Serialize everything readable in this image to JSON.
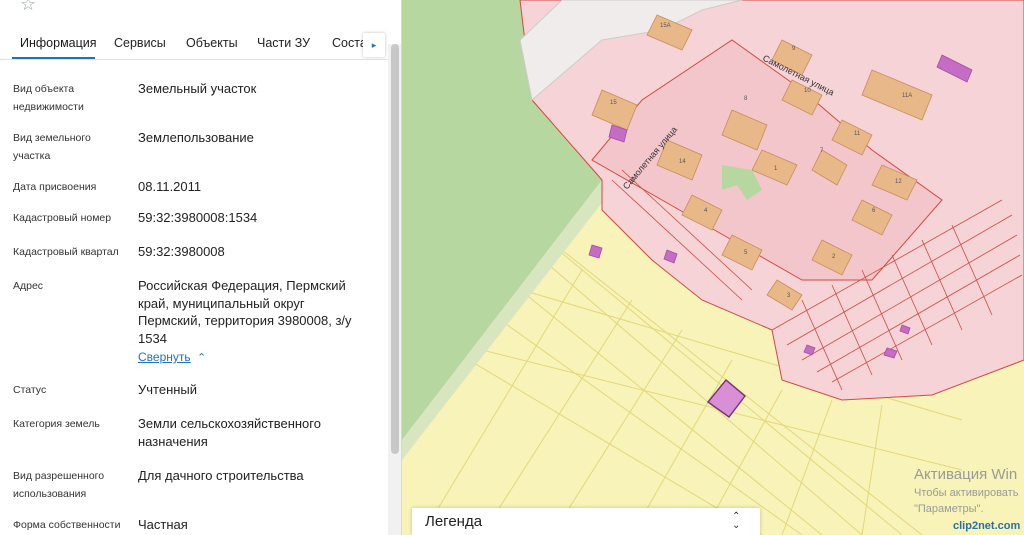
{
  "tabs": [
    {
      "label": "Информация"
    },
    {
      "label": "Сервисы"
    },
    {
      "label": "Объекты"
    },
    {
      "label": "Части ЗУ"
    },
    {
      "label": "Соста"
    }
  ],
  "tab_more": "▸",
  "fields": [
    {
      "label": "Вид объекта недвижимости",
      "value": "Земельный участок"
    },
    {
      "label": "Вид земельного участка",
      "value": "Землепользование"
    },
    {
      "label": "Дата присвоения",
      "value": "08.11.2011"
    },
    {
      "label": "Кадастровый номер",
      "value": "59:32:3980008:1534"
    },
    {
      "label": "Кадастровый квартал",
      "value": "59:32:3980008"
    },
    {
      "label": "Адрес",
      "value": "Российская Федерация, Пермский край, муниципальный округ Пермский, территория 3980008, з/у 1534"
    },
    {
      "label": "Статус",
      "value": "Учтенный"
    },
    {
      "label": "Категория земель",
      "value": "Земли сельскохозяйственного назначения"
    },
    {
      "label": "Вид разрешенного использования",
      "value": "Для дачного строительства"
    },
    {
      "label": "Форма собственности",
      "value": "Частная"
    }
  ],
  "address_toggle": "Свернуть",
  "map": {
    "streets": [
      "Самолетная улица",
      "Самолетная улица"
    ],
    "house_numbers": [
      "15А",
      "15",
      "14",
      "9",
      "8",
      "10",
      "11",
      "11А",
      "12",
      "7",
      "6",
      "4",
      "5",
      "3",
      "2",
      "1"
    ],
    "legend_title": "Легенда",
    "activation_title": "Активация Win",
    "activation_line1": "Чтобы активировать",
    "activation_line2": "\"Параметры\".",
    "clip_watermark": "clip2net.com"
  },
  "colors": {
    "accent": "#1e73be",
    "map_field": "#f8f3b8",
    "map_green": "#b7d7a0",
    "parcel_pink": "#f5d3d7",
    "parcel_border": "#d4493f",
    "building": "#e8b889",
    "selected_parcel": "#c56cc4"
  }
}
